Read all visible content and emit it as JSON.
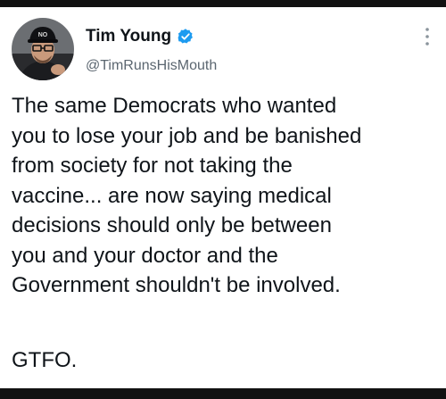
{
  "user": {
    "display_name": "Tim Young",
    "handle": "@TimRunsHisMouth",
    "verified": true,
    "avatar_hat_text": "NO"
  },
  "tweet": {
    "lines": [
      "The same Democrats who wanted",
      "you to lose your job and be banished",
      "from society for not taking the",
      "vaccine... are now saying medical",
      "decisions should only be between",
      "you and your doctor and the",
      "Government shouldn't be involved."
    ],
    "signoff": "GTFO."
  },
  "colors": {
    "verified_badge": "#1d9bf0",
    "text": "#0f1419",
    "secondary_text": "#5b6670",
    "frame": "#121212"
  }
}
